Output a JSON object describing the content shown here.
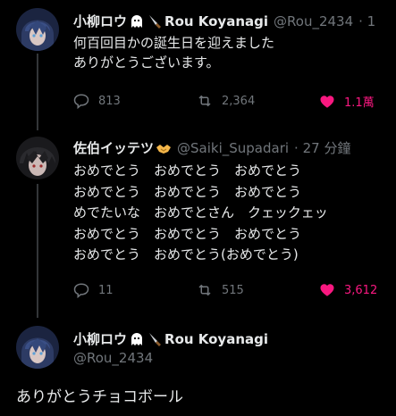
{
  "tweet1": {
    "author_name": "小柳ロウ",
    "author_name_suffix": "Rou Koyanagi",
    "handle": "@Rou_2434",
    "time": "· 1",
    "text": "何百回目かの誕生日を迎えました\nありがとうございます。",
    "replies": "813",
    "retweets": "2,364",
    "likes": "1.1萬"
  },
  "tweet2": {
    "author_name": "佐伯イッテツ",
    "handle": "@Saiki_Supadari",
    "time": "· 27 分鐘",
    "text": "おめでとう　おめでとう　おめでとう\nおめでとう　おめでとう　おめでとう\nめでたいな　おめでとさん　クェックェッ\nおめでとう　おめでとう　おめでとう\nおめでとう　おめでとう(おめでとう)",
    "replies": "11",
    "retweets": "515",
    "likes": "3,612"
  },
  "tweet3": {
    "author_name": "小柳ロウ",
    "author_name_suffix": "Rou Koyanagi",
    "handle": "@Rou_2434",
    "text": "ありがとうチョコボール"
  },
  "colors": {
    "background": "#000000",
    "text": "#e7e9ea",
    "muted": "#71767b",
    "like": "#f91880",
    "line": "#333639"
  }
}
